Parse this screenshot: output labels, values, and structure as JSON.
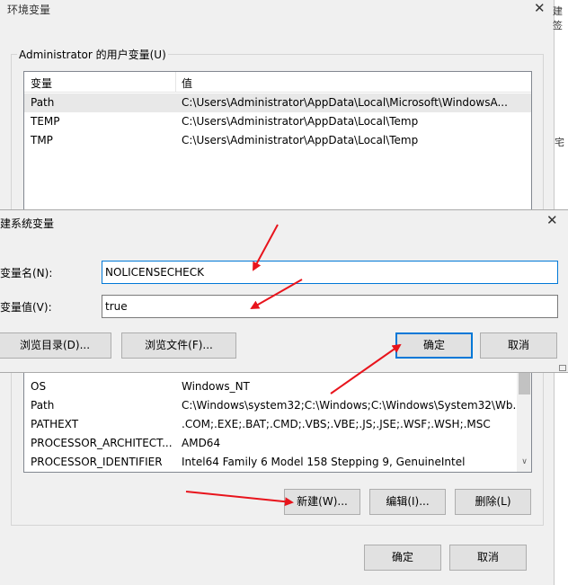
{
  "window": {
    "title": "环境变量",
    "close_glyph": "✕",
    "right_edge_text": [
      "建签",
      "宅"
    ]
  },
  "user_vars": {
    "group_label": "Administrator 的用户变量(U)",
    "columns": [
      "变量",
      "值"
    ],
    "rows": [
      {
        "name": "Path",
        "value": "C:\\Users\\Administrator\\AppData\\Local\\Microsoft\\WindowsA..."
      },
      {
        "name": "TEMP",
        "value": "C:\\Users\\Administrator\\AppData\\Local\\Temp"
      },
      {
        "name": "TMP",
        "value": "C:\\Users\\Administrator\\AppData\\Local\\Temp"
      }
    ]
  },
  "system_vars": {
    "rows": [
      {
        "name": "OS",
        "value": "Windows_NT"
      },
      {
        "name": "Path",
        "value": "C:\\Windows\\system32;C:\\Windows;C:\\Windows\\System32\\Wb..."
      },
      {
        "name": "PATHEXT",
        "value": ".COM;.EXE;.BAT;.CMD;.VBS;.VBE;.JS;.JSE;.WSF;.WSH;.MSC"
      },
      {
        "name": "PROCESSOR_ARCHITECT...",
        "value": "AMD64"
      },
      {
        "name": "PROCESSOR_IDENTIFIER",
        "value": "Intel64 Family 6 Model 158 Stepping 9, GenuineIntel"
      }
    ],
    "buttons": {
      "new": "新建(W)...",
      "edit": "编辑(I)...",
      "delete": "删除(L)"
    }
  },
  "main_buttons": {
    "ok": "确定",
    "cancel": "取消"
  },
  "dialog": {
    "title": "建系统变量",
    "close_glyph": "✕",
    "name_label": "变量名(N):",
    "value_label": "变量值(V):",
    "name_value": "NOLICENSECHECK",
    "value_value": "true",
    "browse_dir": "浏览目录(D)...",
    "browse_file": "浏览文件(F)...",
    "ok": "确定",
    "cancel": "取消"
  },
  "colors": {
    "arrow": "#e8141c",
    "accent": "#0078d7"
  }
}
